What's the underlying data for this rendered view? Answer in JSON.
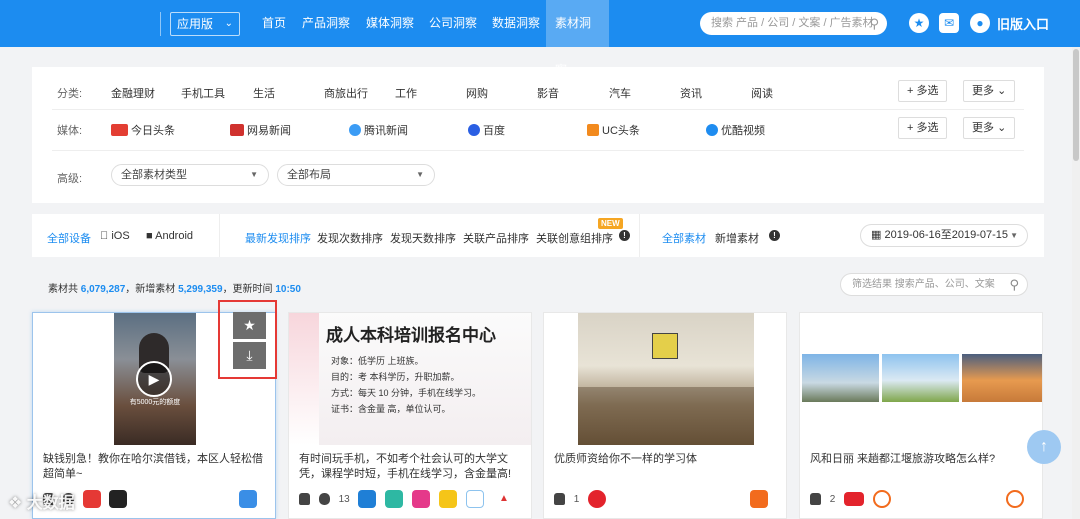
{
  "header": {
    "app_select": "应用版",
    "nav": [
      "首页",
      "产品洞察",
      "媒体洞察",
      "公司洞察",
      "数据洞察",
      "素材洞察"
    ],
    "search_placeholder": "搜索 产品 / 公司 / 文案 / 广告素材",
    "old_version": "旧版入口",
    "accent": "#1c8cf0"
  },
  "filters": {
    "category_label": "分类:",
    "categories": [
      "金融理财",
      "手机工具",
      "生活",
      "商旅出行",
      "工作",
      "网购",
      "影音",
      "汽车",
      "资讯",
      "阅读"
    ],
    "media_label": "媒体:",
    "media": [
      {
        "label": "今日头条",
        "badge": "头条",
        "color": "#e33e33"
      },
      {
        "label": "网易新闻",
        "badge": "网易",
        "color": "#d0322e"
      },
      {
        "label": "腾讯新闻",
        "badge": "",
        "color": "#3b9cf5"
      },
      {
        "label": "百度",
        "badge": "",
        "color": "#2a5fe3"
      },
      {
        "label": "UC头条",
        "badge": "",
        "color": "#f28a1e"
      },
      {
        "label": "优酷视频",
        "badge": "",
        "color": "#1e8cf0"
      }
    ],
    "multi_select": "+ 多选",
    "more": "更多",
    "advanced_label": "高级:",
    "type_select": "全部素材类型",
    "layout_select": "全部布局"
  },
  "sort_bar": {
    "devices": [
      "全部设备",
      "iOS",
      "Android"
    ],
    "sorts": [
      "最新发现排序",
      "发现次数排序",
      "发现天数排序",
      "关联产品排序",
      "关联创意组排序"
    ],
    "new_badge": "NEW",
    "material_tabs": [
      "全部素材",
      "新增素材"
    ],
    "date_range": "2019-06-16至2019-07-15"
  },
  "stats": {
    "prefix": "素材共",
    "total": "6,079,287",
    "new_prefix": "，新增素材",
    "new_count": "5,299,359",
    "update_prefix": "，更新时间",
    "update_time": "10:50"
  },
  "result_search_placeholder": "筛选结果 搜索产品、公司、文案",
  "cards": [
    {
      "title": "缺钱别急！教你在哈尔滨借钱，本区人轻松借超简单~",
      "count": "",
      "video_caption": "有5000元的额度"
    },
    {
      "title": "有时间玩手机，不如考个社会认可的大学文凭，课程学时短，手机在线学习，含金量高!",
      "count": "13",
      "poster_title": "成人本科培训报名中心",
      "poster_lines": [
        "对象：低学历 上班族。",
        "目的：考 本科学历，升职加薪。",
        "方式：每天 10 分钟，手机在线学习。",
        "证书：含金量 高，单位认可。"
      ]
    },
    {
      "title": "优质师资给你不一样的学习体",
      "count": "1"
    },
    {
      "title": "风和日丽 来趟都江堰旅游攻略怎么样?",
      "count": "2"
    }
  ],
  "watermark": "大数据"
}
